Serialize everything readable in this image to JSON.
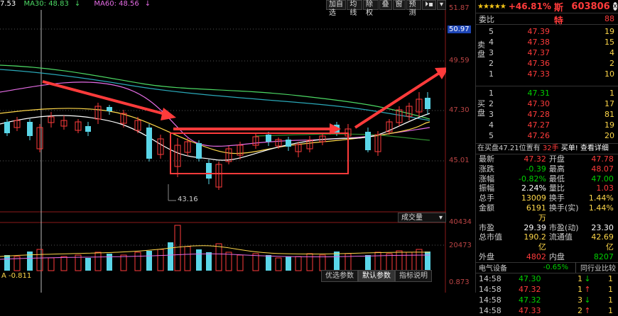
{
  "ma_legend": {
    "ma5": "7.53",
    "ma30_label": "MA30: 48.83",
    "ma60_label": "MA60: 48.56",
    "down_arrow": "↓",
    "colors": {
      "ma5": "#ffffff",
      "ma30": "#4cd964",
      "ma60": "#e56ce5"
    }
  },
  "toolbar": {
    "buttons": [
      "加自选",
      "均线",
      "除权",
      "叠",
      "窗",
      "预测",
      "⏵▪",
      "▾"
    ]
  },
  "price_axis": {
    "labels": [
      "51.87",
      "50.97",
      "49.59",
      "47.30",
      "45.01"
    ],
    "highlight": "50.97"
  },
  "low_marker": "43.16",
  "volume": {
    "selector_label": "成交量",
    "axis_labels": [
      "40434",
      "20473",
      "0.873"
    ],
    "indicator_value": "A -0.811",
    "colors": {
      "up": "#ff3b3b",
      "down": "#5ad6e8"
    }
  },
  "bottom_tabs": [
    "优选参数",
    "默认参数",
    "指标说明"
  ],
  "panel": {
    "stars": "★★★★★",
    "pct": "+46.81%",
    "name": "福斯特",
    "code": "603806",
    "close_icon": "x",
    "weibi_label": "委比",
    "weibi_value": "88",
    "sell_label": "卖盘",
    "buy_label": "买盘",
    "asks": [
      {
        "lv": "5",
        "price": "47.39",
        "vol": "19"
      },
      {
        "lv": "4",
        "price": "47.38",
        "vol": "15"
      },
      {
        "lv": "3",
        "price": "47.37",
        "vol": "4"
      },
      {
        "lv": "2",
        "price": "47.36",
        "vol": "2"
      },
      {
        "lv": "1",
        "price": "47.33",
        "vol": "10"
      }
    ],
    "bids": [
      {
        "lv": "1",
        "price": "47.31",
        "vol": "1"
      },
      {
        "lv": "2",
        "price": "47.30",
        "vol": "17"
      },
      {
        "lv": "3",
        "price": "47.28",
        "vol": "81"
      },
      {
        "lv": "4",
        "price": "47.27",
        "vol": "19"
      },
      {
        "lv": "5",
        "price": "47.26",
        "vol": "20"
      }
    ],
    "bid_note": "在买盘47.21位置有",
    "bid_note_hands": "32手",
    "bid_note_link": "买单! 查看详细",
    "quote": [
      {
        "k1": "最新",
        "v1": "47.32",
        "c1": "red",
        "k2": "开盘",
        "v2": "47.78",
        "c2": "red"
      },
      {
        "k1": "涨跌",
        "v1": "-0.39",
        "c1": "green",
        "k2": "最高",
        "v2": "48.07",
        "c2": "red"
      },
      {
        "k1": "涨幅",
        "v1": "-0.82%",
        "c1": "green",
        "k2": "最低",
        "v2": "47.00",
        "c2": "green"
      },
      {
        "k1": "振幅",
        "v1": "2.24%",
        "c1": "white",
        "k2": "量比",
        "v2": "1.03",
        "c2": "red"
      },
      {
        "k1": "总手",
        "v1": "13009",
        "c1": "yellow",
        "k2": "换手",
        "v2": "1.44%",
        "c2": "yellow"
      },
      {
        "k1": "金额",
        "v1": "6191万",
        "c1": "yellow",
        "k2": "换手(实)",
        "v2": "1.44%",
        "c2": "yellow"
      },
      {
        "k1": "市盈",
        "v1": "29.39",
        "c1": "white",
        "k2": "市盈(动)",
        "v2": "23.30",
        "c2": "white"
      },
      {
        "k1": "总市值",
        "v1": "190.2亿",
        "c1": "yellow",
        "k2": "流通值",
        "v2": "42.69亿",
        "c2": "yellow"
      },
      {
        "k1": "外盘",
        "v1": "4802",
        "c1": "red",
        "k2": "内盘",
        "v2": "8207",
        "c2": "green"
      }
    ],
    "industry": {
      "label": "电气设备",
      "pct": "-0.65%",
      "compare": "同行业比较"
    },
    "ticks": [
      {
        "time": "14:58",
        "price": "47.30",
        "vol": "1",
        "dir": "↓",
        "count": "1",
        "c": "green"
      },
      {
        "time": "14:58",
        "price": "47.32",
        "vol": "1",
        "dir": "↑",
        "count": "1",
        "c": "red"
      },
      {
        "time": "14:58",
        "price": "47.32",
        "vol": "3",
        "dir": "↓",
        "count": "1",
        "c": "green"
      },
      {
        "time": "14:58",
        "price": "47.33",
        "vol": "2",
        "dir": "↑",
        "count": "1",
        "c": "red"
      }
    ]
  }
}
